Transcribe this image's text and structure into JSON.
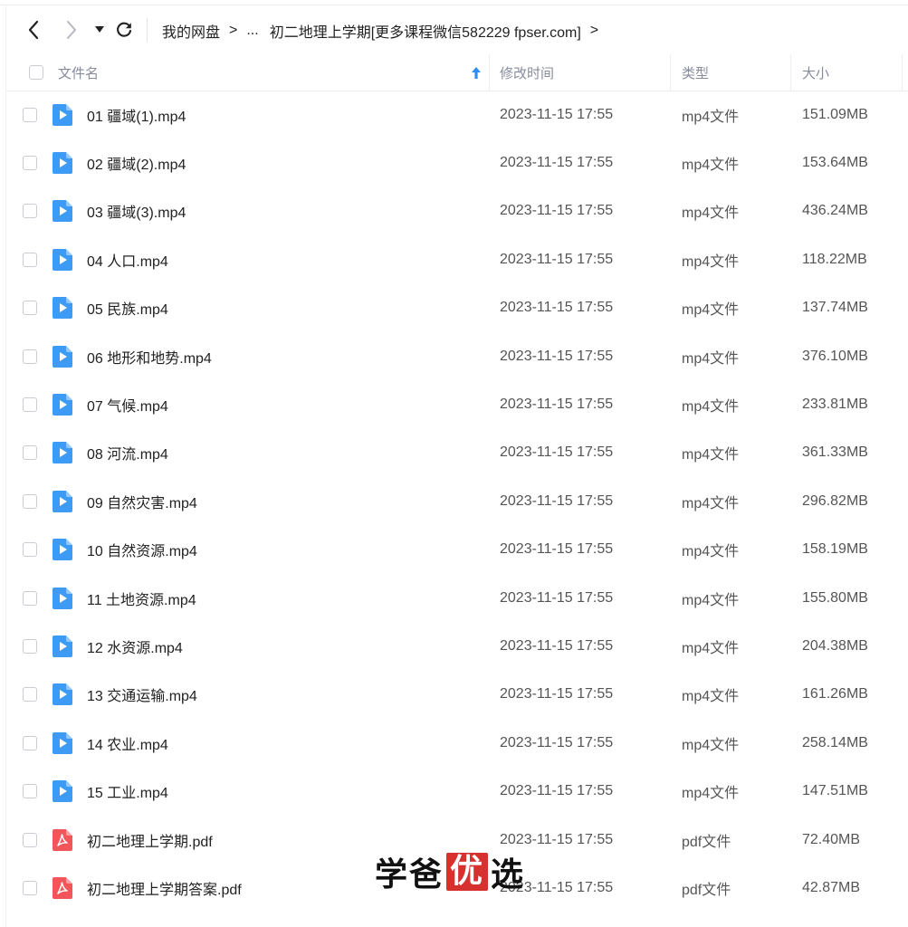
{
  "nav": {
    "breadcrumb": [
      "我的网盘",
      "...",
      "初二地理上学期[更多课程微信582229 fpser.com]"
    ],
    "sep": ">"
  },
  "columns": {
    "name": "文件名",
    "modified": "修改时间",
    "type": "类型",
    "size": "大小"
  },
  "files": [
    {
      "name": "01 疆域(1).mp4",
      "modified": "2023-11-15 17:55",
      "type": "mp4文件",
      "size": "151.09MB",
      "icon": "video-file-icon"
    },
    {
      "name": "02 疆域(2).mp4",
      "modified": "2023-11-15 17:55",
      "type": "mp4文件",
      "size": "153.64MB",
      "icon": "video-file-icon"
    },
    {
      "name": "03 疆域(3).mp4",
      "modified": "2023-11-15 17:55",
      "type": "mp4文件",
      "size": "436.24MB",
      "icon": "video-file-icon"
    },
    {
      "name": "04 人口.mp4",
      "modified": "2023-11-15 17:55",
      "type": "mp4文件",
      "size": "118.22MB",
      "icon": "video-file-icon"
    },
    {
      "name": "05 民族.mp4",
      "modified": "2023-11-15 17:55",
      "type": "mp4文件",
      "size": "137.74MB",
      "icon": "video-file-icon"
    },
    {
      "name": "06 地形和地势.mp4",
      "modified": "2023-11-15 17:55",
      "type": "mp4文件",
      "size": "376.10MB",
      "icon": "video-file-icon"
    },
    {
      "name": "07 气候.mp4",
      "modified": "2023-11-15 17:55",
      "type": "mp4文件",
      "size": "233.81MB",
      "icon": "video-file-icon"
    },
    {
      "name": "08 河流.mp4",
      "modified": "2023-11-15 17:55",
      "type": "mp4文件",
      "size": "361.33MB",
      "icon": "video-file-icon"
    },
    {
      "name": "09 自然灾害.mp4",
      "modified": "2023-11-15 17:55",
      "type": "mp4文件",
      "size": "296.82MB",
      "icon": "video-file-icon"
    },
    {
      "name": "10 自然资源.mp4",
      "modified": "2023-11-15 17:55",
      "type": "mp4文件",
      "size": "158.19MB",
      "icon": "video-file-icon"
    },
    {
      "name": "11 土地资源.mp4",
      "modified": "2023-11-15 17:55",
      "type": "mp4文件",
      "size": "155.80MB",
      "icon": "video-file-icon"
    },
    {
      "name": "12 水资源.mp4",
      "modified": "2023-11-15 17:55",
      "type": "mp4文件",
      "size": "204.38MB",
      "icon": "video-file-icon"
    },
    {
      "name": "13 交通运输.mp4",
      "modified": "2023-11-15 17:55",
      "type": "mp4文件",
      "size": "161.26MB",
      "icon": "video-file-icon"
    },
    {
      "name": "14 农业.mp4",
      "modified": "2023-11-15 17:55",
      "type": "mp4文件",
      "size": "258.14MB",
      "icon": "video-file-icon"
    },
    {
      "name": "15 工业.mp4",
      "modified": "2023-11-15 17:55",
      "type": "mp4文件",
      "size": "147.51MB",
      "icon": "video-file-icon"
    },
    {
      "name": "初二地理上学期.pdf",
      "modified": "2023-11-15 17:55",
      "type": "pdf文件",
      "size": "72.40MB",
      "icon": "pdf-file-icon"
    },
    {
      "name": "初二地理上学期答案.pdf",
      "modified": "2023-11-15 17:55",
      "type": "pdf文件",
      "size": "42.87MB",
      "icon": "pdf-file-icon"
    }
  ],
  "watermark": {
    "part1": "学爸",
    "part2": "优",
    "part3": "选"
  },
  "colors": {
    "video": "#3d9bf6",
    "pdf": "#f2555a",
    "sort_arrow": "#2f8ef5",
    "watermark_red": "#d6312f"
  }
}
